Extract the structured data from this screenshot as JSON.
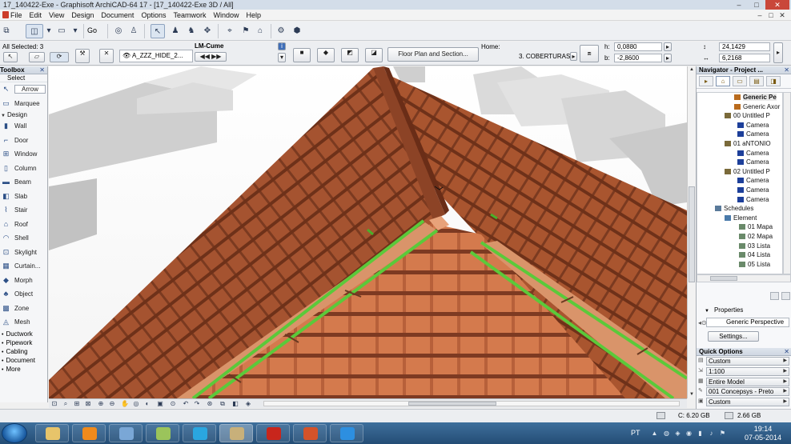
{
  "window": {
    "title": "17_140422-Exe - Graphisoft ArchiCAD-64 17 - [17_140422-Exe 3D / All]",
    "minimize": "–",
    "maximize": "□",
    "close": "✕"
  },
  "menu": {
    "items": [
      "File",
      "Edit",
      "View",
      "Design",
      "Document",
      "Options",
      "Teamwork",
      "Window",
      "Help"
    ],
    "doc_buttons": [
      "–",
      "□",
      "✕"
    ]
  },
  "toolbar": {
    "go_label": "Go"
  },
  "infobox": {
    "all_selected": "All Selected: 3",
    "layer": "A_ZZZ_HIDE_2...",
    "profile": "LM-Cume",
    "view_button": "Floor Plan and Section...",
    "home_label": "Home:",
    "home_story": "3. COBERTURAS",
    "h_label": "h:",
    "h_value": "0,0880",
    "b_label": "b:",
    "b_value": "-2,8600",
    "dim1": "24,1429",
    "dim2": "6,2168"
  },
  "toolbox": {
    "title": "Toolbox",
    "close": "✕",
    "select_header": "Select",
    "select_tools": [
      {
        "label": "Arrow",
        "icon": "arrow-icon",
        "active": true
      },
      {
        "label": "Marquee",
        "icon": "marquee-icon",
        "active": false
      }
    ],
    "design_header": "Design",
    "design_tools": [
      {
        "label": "Wall",
        "icon": "wall-icon"
      },
      {
        "label": "Door",
        "icon": "door-icon"
      },
      {
        "label": "Window",
        "icon": "window-icon"
      },
      {
        "label": "Column",
        "icon": "column-icon"
      },
      {
        "label": "Beam",
        "icon": "beam-icon"
      },
      {
        "label": "Slab",
        "icon": "slab-icon"
      },
      {
        "label": "Stair",
        "icon": "stair-icon"
      },
      {
        "label": "Roof",
        "icon": "roof-icon"
      },
      {
        "label": "Shell",
        "icon": "shell-icon"
      },
      {
        "label": "Skylight",
        "icon": "skylight-icon"
      },
      {
        "label": "Curtain...",
        "icon": "curtain-wall-icon"
      },
      {
        "label": "Morph",
        "icon": "morph-icon"
      },
      {
        "label": "Object",
        "icon": "object-icon"
      },
      {
        "label": "Zone",
        "icon": "zone-icon"
      },
      {
        "label": "Mesh",
        "icon": "mesh-icon"
      }
    ],
    "groups": [
      "Ductwork",
      "Pipework",
      "Cabling",
      "Document",
      "More"
    ]
  },
  "navigator": {
    "title": "Navigator - Project ...",
    "close": "✕",
    "tree": [
      {
        "label": "Generic Pe",
        "indent": 46,
        "icon": "perspective-icon",
        "selected": true
      },
      {
        "label": "Generic Axor",
        "indent": 46,
        "icon": "axonometry-icon",
        "selected": false
      },
      {
        "label": "00 Untitled P",
        "indent": 34,
        "icon": "path-icon",
        "selected": false
      },
      {
        "label": "Camera",
        "indent": 50,
        "icon": "camera-icon",
        "selected": false
      },
      {
        "label": "Camera",
        "indent": 50,
        "icon": "camera-icon",
        "selected": false
      },
      {
        "label": "01 aNTONIO",
        "indent": 34,
        "icon": "path-icon",
        "selected": false
      },
      {
        "label": "Camera",
        "indent": 50,
        "icon": "camera-icon",
        "selected": false
      },
      {
        "label": "Camera",
        "indent": 50,
        "icon": "camera-icon",
        "selected": false
      },
      {
        "label": "02 Untitled P",
        "indent": 34,
        "icon": "path-icon",
        "selected": false
      },
      {
        "label": "Camera",
        "indent": 50,
        "icon": "camera-icon",
        "selected": false
      },
      {
        "label": "Camera",
        "indent": 50,
        "icon": "camera-icon",
        "selected": false
      },
      {
        "label": "Camera",
        "indent": 50,
        "icon": "camera-icon",
        "selected": false
      },
      {
        "label": "Schedules",
        "indent": 22,
        "icon": "schedules-icon",
        "selected": false
      },
      {
        "label": "Element",
        "indent": 34,
        "icon": "folder-icon",
        "selected": false
      },
      {
        "label": "01 Mapa",
        "indent": 52,
        "icon": "schedule-doc-icon",
        "selected": false
      },
      {
        "label": "02 Mapa",
        "indent": 52,
        "icon": "schedule-doc-icon",
        "selected": false
      },
      {
        "label": "03 Lista",
        "indent": 52,
        "icon": "schedule-doc-icon",
        "selected": false
      },
      {
        "label": "04 Lista",
        "indent": 52,
        "icon": "schedule-doc-icon",
        "selected": false
      },
      {
        "label": "05 Lista",
        "indent": 52,
        "icon": "schedule-doc-icon",
        "selected": false
      }
    ],
    "properties_label": "Properties",
    "properties_value": "Generic Perspective",
    "settings_button": "Settings..."
  },
  "quick_options": {
    "title": "Quick Options",
    "close": "✕",
    "rows": [
      {
        "value": "Custom",
        "icon": "layer-combination-icon"
      },
      {
        "value": "1:100",
        "icon": "scale-icon"
      },
      {
        "value": "Entire Model",
        "icon": "structure-display-icon"
      },
      {
        "value": "001 Concepsys - Preto",
        "icon": "pen-set-icon"
      },
      {
        "value": "Custom",
        "icon": "model-view-icon"
      }
    ]
  },
  "status": {
    "disk_c": "C: 6.20 GB",
    "memory": "2.66 GB"
  },
  "taskbar": {
    "apps": [
      "explorer-icon",
      "media-player-icon",
      "window-manager-icon",
      "archicad-alt-icon",
      "skype-icon",
      "archicad-icon",
      "acrobat-icon",
      "powerpoint-icon",
      "internet-explorer-icon"
    ],
    "language": "PT",
    "time": "19:14",
    "date": "07-05-2014"
  },
  "colors": {
    "roof_tile": "#a6542d",
    "roof_tile_light": "#d27a4f",
    "ridge_selected": "#5bc93a",
    "title_bar": "#d3dde9"
  }
}
